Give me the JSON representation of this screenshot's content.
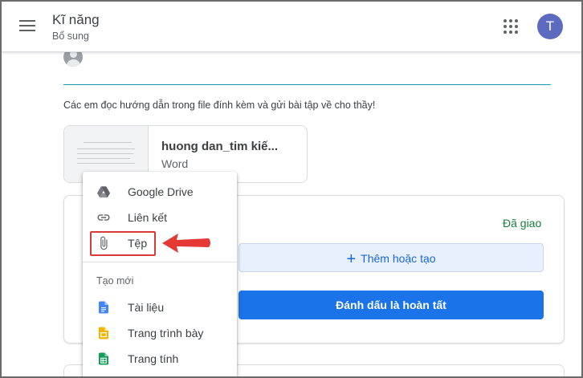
{
  "header": {
    "title": "Kĩ năng",
    "subtitle": "Bổ sung",
    "avatar_letter": "T"
  },
  "post": {
    "description": "Các em đọc hướng dẫn trong file đính kèm và gửi bài tập về cho thầy!"
  },
  "attachment": {
    "title": "huong dan_tim kiế...",
    "type": "Word"
  },
  "work": {
    "status": "Đã giao",
    "add_label": "Thêm hoặc tạo",
    "done_label": "Đánh dấu là hoàn tất"
  },
  "menu": {
    "items": [
      {
        "label": "Google Drive",
        "icon": "google-drive-icon"
      },
      {
        "label": "Liên kết",
        "icon": "link-icon"
      },
      {
        "label": "Tệp",
        "icon": "paperclip-icon"
      }
    ],
    "create_section": "Tạo mới",
    "create_items": [
      {
        "label": "Tài liệu",
        "icon": "docs-icon",
        "color": "#4285f4"
      },
      {
        "label": "Trang trình bày",
        "icon": "slides-icon",
        "color": "#f4b400"
      },
      {
        "label": "Trang tính",
        "icon": "sheets-icon",
        "color": "#0f9d58"
      }
    ]
  },
  "colors": {
    "accent": "#1a73e8",
    "status_green": "#188038",
    "highlight_red": "#d93a3a",
    "divider_teal": "#129eaf"
  }
}
